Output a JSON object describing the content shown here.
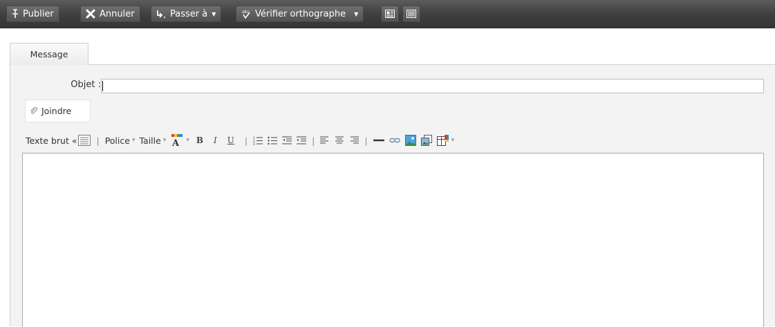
{
  "toolbar": {
    "publish_label": "Publier",
    "cancel_label": "Annuler",
    "goto_label": "Passer à",
    "spellcheck_label": "Vérifier orthographe"
  },
  "tabs": [
    {
      "label": "Message"
    }
  ],
  "form": {
    "subject_label": "Objet :",
    "subject_value": "",
    "attach_label": "Joindre"
  },
  "editor_toolbar": {
    "plain_text_label": "Texte brut «",
    "font_label": "Police",
    "size_label": "Taille",
    "bold": "B",
    "italic": "I",
    "underline": "U"
  },
  "icons": {
    "publish": "pin-icon",
    "cancel": "x-icon",
    "goto": "goto-icon",
    "spellcheck": "spellcheck-icon",
    "attach": "paperclip-icon"
  },
  "colors": {
    "toolbar_bg": "#3e3e3e",
    "panel_bg": "#f3f3f3",
    "editor_bg": "#ffffff"
  }
}
